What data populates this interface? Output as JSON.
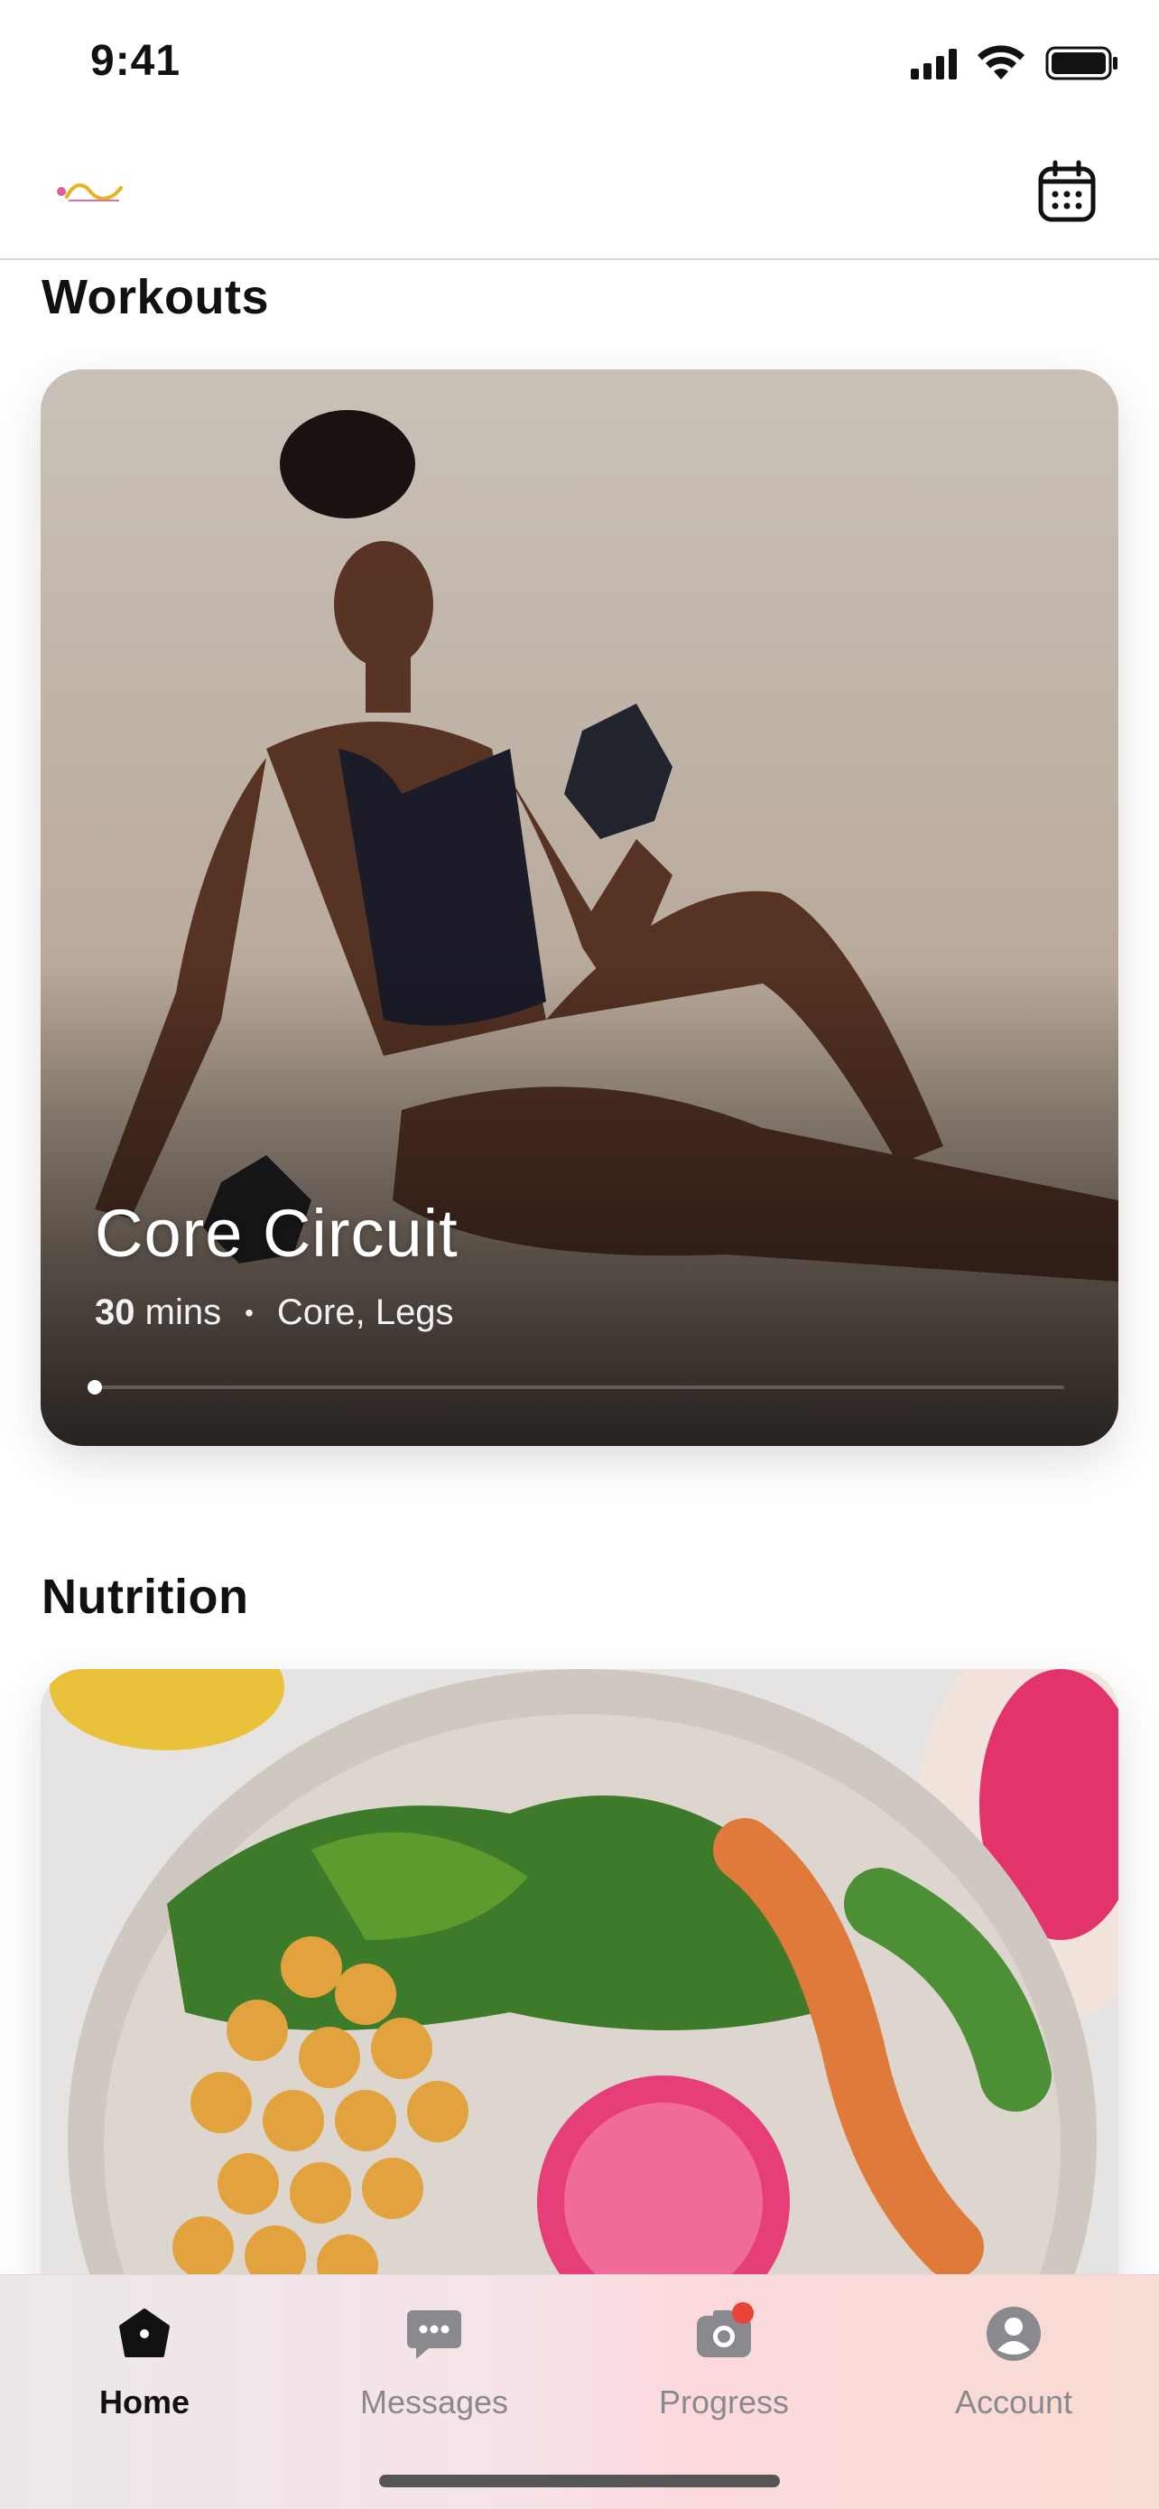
{
  "status_bar": {
    "time": "9:41"
  },
  "header": {
    "logo_icon": "sculpted-logo",
    "calendar_icon": "calendar-icon"
  },
  "workouts": {
    "section_title": "Workouts",
    "card": {
      "title": "Core Circuit",
      "duration_value": "30",
      "duration_unit": "mins",
      "separator": "•",
      "categories": "Core, Legs",
      "progress": 0.0
    }
  },
  "nutrition": {
    "section_title": "Nutrition"
  },
  "tab_bar": {
    "tabs": [
      {
        "label": "Home",
        "icon": "home-icon",
        "active": true
      },
      {
        "label": "Messages",
        "icon": "chat-bubble-icon",
        "active": false
      },
      {
        "label": "Progress",
        "icon": "camera-icon",
        "active": false,
        "badge": true
      },
      {
        "label": "Account",
        "icon": "person-icon",
        "active": false
      }
    ]
  },
  "colors": {
    "accent": "#111111",
    "inactive": "#8a8a8e",
    "badge": "#e8443a"
  }
}
